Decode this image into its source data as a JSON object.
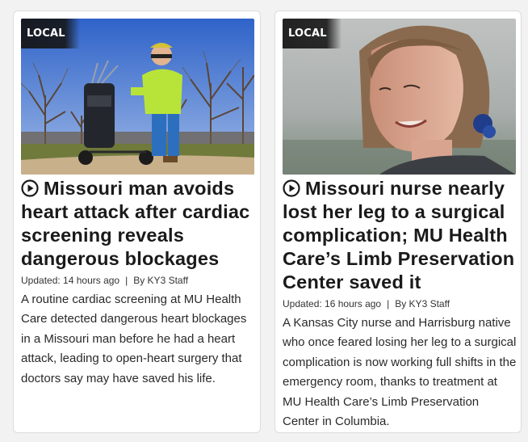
{
  "cards": [
    {
      "badge": "LOCAL",
      "headline": "Missouri man avoids heart attack after cardiac screening reveals dangerous blockages",
      "updated": "Updated: 14 hours ago",
      "separator": "|",
      "byline": "By KY3 Staff",
      "summary": "A routine cardiac screening at MU Health Care detected dangerous heart blockages in a Missouri man before he had a heart attack, leading to open-heart surgery that doctors say may have saved his life."
    },
    {
      "badge": "LOCAL",
      "headline": "Missouri nurse nearly lost her leg to a surgical complication; MU Health Care’s Limb Preservation Center saved it",
      "updated": "Updated: 16 hours ago",
      "separator": "|",
      "byline": "By KY3 Staff",
      "summary": "A Kansas City nurse and Harrisburg native who once feared losing her leg to a surgical complication is now working full shifts in the emergency room, thanks to treatment at MU Health Care’s Limb Preservation Center in Columbia."
    }
  ],
  "icons": {
    "video": "play-circle-icon"
  },
  "colors": {
    "badge_bg": "#141414",
    "text": "#1a1a1a",
    "card_border": "#dcdcdc"
  }
}
